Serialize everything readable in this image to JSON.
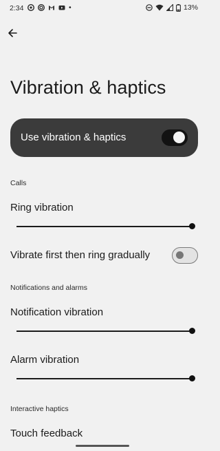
{
  "status_bar": {
    "time": "2:34",
    "battery": "13%",
    "dot": "•",
    "notification_icons": [
      "chrome-icon",
      "record-icon",
      "gmail-icon",
      "youtube-icon"
    ],
    "system_icons": [
      "dnd-icon",
      "wifi-icon",
      "signal-icon",
      "battery-icon"
    ]
  },
  "header": {
    "back_icon": "arrow-left-icon",
    "title": "Vibration & haptics"
  },
  "master": {
    "label": "Use vibration & haptics",
    "enabled": true
  },
  "sections": {
    "calls": "Calls",
    "notifications": "Notifications and alarms",
    "interactive": "Interactive haptics"
  },
  "settings": {
    "ring_vibration": {
      "label": "Ring vibration",
      "level": 1.0
    },
    "vibrate_first": {
      "label": "Vibrate first then ring gradually",
      "enabled": false
    },
    "notification_vibration": {
      "label": "Notification vibration",
      "level": 1.0
    },
    "alarm_vibration": {
      "label": "Alarm vibration",
      "level": 1.0
    },
    "touch_feedback": {
      "label": "Touch feedback"
    }
  },
  "colors": {
    "background": "#f1f1f1",
    "card": "#3b3b3b",
    "accent": "#121212"
  }
}
